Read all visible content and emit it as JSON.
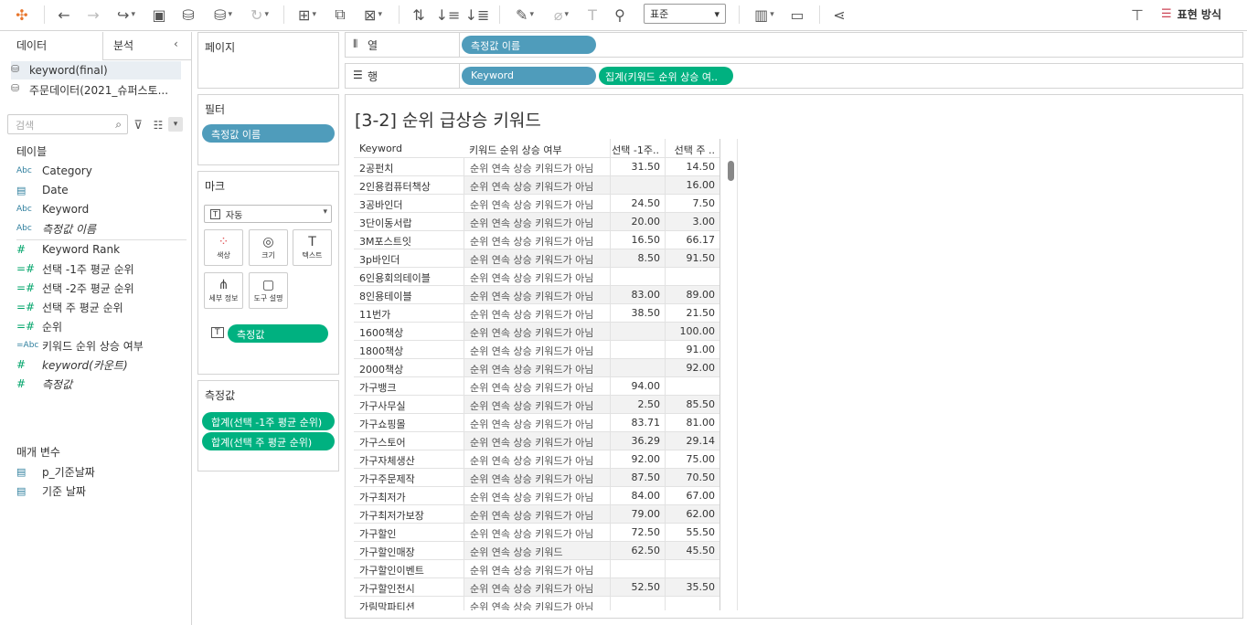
{
  "toolbar": {
    "fit_value": "표준",
    "show_me": "표현 방식"
  },
  "left": {
    "tab_data": "데이터",
    "tab_analytics": "분석",
    "collapse_icon": "‹",
    "datasources": [
      "keyword(final)",
      "주문데이터(2021_슈퍼스토..."
    ],
    "search_placeholder": "검색",
    "tables_title": "테이블",
    "fields": [
      {
        "type": "Abc",
        "name": "Category",
        "italic": false
      },
      {
        "type": "date",
        "name": "Date",
        "italic": false
      },
      {
        "type": "Abc",
        "name": "Keyword",
        "italic": false
      },
      {
        "type": "Abc",
        "name": "측정값 이름",
        "italic": true
      },
      {
        "type": "#",
        "name": "Keyword Rank",
        "italic": false
      },
      {
        "type": "=#",
        "name": "선택 -1주 평균 순위",
        "italic": false
      },
      {
        "type": "=#",
        "name": "선택 -2주 평균 순위",
        "italic": false
      },
      {
        "type": "=#",
        "name": "선택 주 평균 순위",
        "italic": false
      },
      {
        "type": "=#",
        "name": "순위",
        "italic": false
      },
      {
        "type": "=Abc",
        "name": "키워드 순위 상승 여부",
        "italic": false
      },
      {
        "type": "#",
        "name": "keyword(카운트)",
        "italic": true
      },
      {
        "type": "#",
        "name": "측정값",
        "italic": true
      }
    ],
    "params_title": "매개 변수",
    "params": [
      "p_기준날짜",
      "기준 날짜"
    ]
  },
  "cards": {
    "pages_title": "페이지",
    "filters_title": "필터",
    "filter_pill": "측정값 이름",
    "marks_title": "마크",
    "mark_type": "자동",
    "mark_buttons": [
      "색상",
      "크기",
      "텍스트",
      "세부 정보",
      "도구 설명"
    ],
    "marks_pill": "측정값",
    "measures_title": "측정값",
    "measure_pills": [
      "합계(선택 -1주 평균 순위)",
      "합계(선택 주 평균 순위)"
    ]
  },
  "shelves": {
    "columns_label": "열",
    "columns_pill": "측정값 이름",
    "rows_label": "행",
    "rows_pills": [
      "Keyword",
      "집계(키워드 순위 상승 여.."
    ]
  },
  "view": {
    "title": "[3-2] 순위 급상승 키워드",
    "headers": [
      "Keyword",
      "키워드 순위 상승 여부",
      "선택 -1주..",
      "선택 주 .."
    ],
    "rows": [
      [
        "2공펀치",
        "순위 연속 상승 키워드가 아님",
        "31.50",
        "14.50"
      ],
      [
        "2인용컴퓨터책상",
        "순위 연속 상승 키워드가 아님",
        "",
        "16.00"
      ],
      [
        "3공바인더",
        "순위 연속 상승 키워드가 아님",
        "24.50",
        "7.50"
      ],
      [
        "3단이동서랍",
        "순위 연속 상승 키워드가 아님",
        "20.00",
        "3.00"
      ],
      [
        "3M포스트잇",
        "순위 연속 상승 키워드가 아님",
        "16.50",
        "66.17"
      ],
      [
        "3p바인더",
        "순위 연속 상승 키워드가 아님",
        "8.50",
        "91.50"
      ],
      [
        "6인용회의테이블",
        "순위 연속 상승 키워드가 아님",
        "",
        ""
      ],
      [
        "8인용테이블",
        "순위 연속 상승 키워드가 아님",
        "83.00",
        "89.00"
      ],
      [
        "11번가",
        "순위 연속 상승 키워드가 아님",
        "38.50",
        "21.50"
      ],
      [
        "1600책상",
        "순위 연속 상승 키워드가 아님",
        "",
        "100.00"
      ],
      [
        "1800책상",
        "순위 연속 상승 키워드가 아님",
        "",
        "91.00"
      ],
      [
        "2000책상",
        "순위 연속 상승 키워드가 아님",
        "",
        "92.00"
      ],
      [
        "가구뱅크",
        "순위 연속 상승 키워드가 아님",
        "94.00",
        ""
      ],
      [
        "가구사무실",
        "순위 연속 상승 키워드가 아님",
        "2.50",
        "85.50"
      ],
      [
        "가구쇼핑몰",
        "순위 연속 상승 키워드가 아님",
        "83.71",
        "81.00"
      ],
      [
        "가구스토어",
        "순위 연속 상승 키워드가 아님",
        "36.29",
        "29.14"
      ],
      [
        "가구자체생산",
        "순위 연속 상승 키워드가 아님",
        "92.00",
        "75.00"
      ],
      [
        "가구주문제작",
        "순위 연속 상승 키워드가 아님",
        "87.50",
        "70.50"
      ],
      [
        "가구최저가",
        "순위 연속 상승 키워드가 아님",
        "84.00",
        "67.00"
      ],
      [
        "가구최저가보장",
        "순위 연속 상승 키워드가 아님",
        "79.00",
        "62.00"
      ],
      [
        "가구할인",
        "순위 연속 상승 키워드가 아님",
        "72.50",
        "55.50"
      ],
      [
        "가구할인매장",
        "순위 연속 상승 키워드",
        "62.50",
        "45.50"
      ],
      [
        "가구할인이벤트",
        "순위 연속 상승 키워드가 아님",
        "",
        ""
      ],
      [
        "가구할인전시",
        "순위 연속 상승 키워드가 아님",
        "52.50",
        "35.50"
      ],
      [
        "가림막파티션",
        "순위 연속 상승 키워드가 아님",
        "",
        ""
      ]
    ]
  }
}
